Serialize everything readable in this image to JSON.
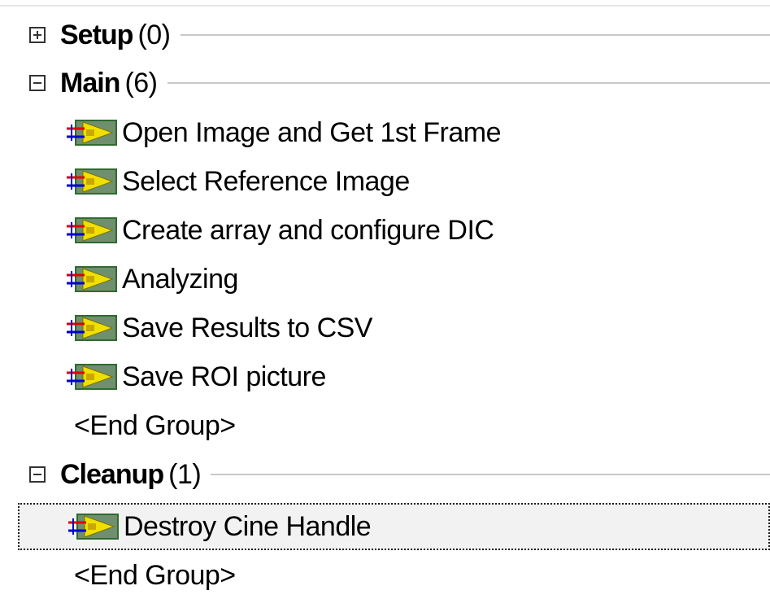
{
  "groups": [
    {
      "name": "Setup",
      "count": "(0)",
      "expander": "plus-icon",
      "steps": [],
      "end_label": ""
    },
    {
      "name": "Main",
      "count": "(6)",
      "expander": "minus-icon",
      "steps": [
        {
          "label": "Open Image and Get 1st Frame",
          "icon": "vi-step-icon"
        },
        {
          "label": "Select Reference Image",
          "icon": "vi-step-icon"
        },
        {
          "label": "Create array and configure DIC",
          "icon": "vi-step-icon"
        },
        {
          "label": "Analyzing",
          "icon": "vi-step-icon"
        },
        {
          "label": "Save Results to CSV",
          "icon": "vi-step-icon"
        },
        {
          "label": "Save ROI picture",
          "icon": "vi-step-icon"
        }
      ],
      "end_label": "<End Group>"
    },
    {
      "name": "Cleanup",
      "count": "(1)",
      "expander": "minus-icon",
      "steps": [
        {
          "label": "Destroy Cine Handle",
          "icon": "vi-step-icon",
          "selected": true
        }
      ],
      "end_label": "<End Group>"
    }
  ],
  "colors": {
    "selection_background": "#f2f2f2",
    "group_rule": "#c8c8c8",
    "icon_wire_red": "#e00000",
    "icon_wire_blue": "#0000d0",
    "icon_vi_yellow": "#f0e000",
    "icon_vi_green": "#2f6b2f"
  }
}
